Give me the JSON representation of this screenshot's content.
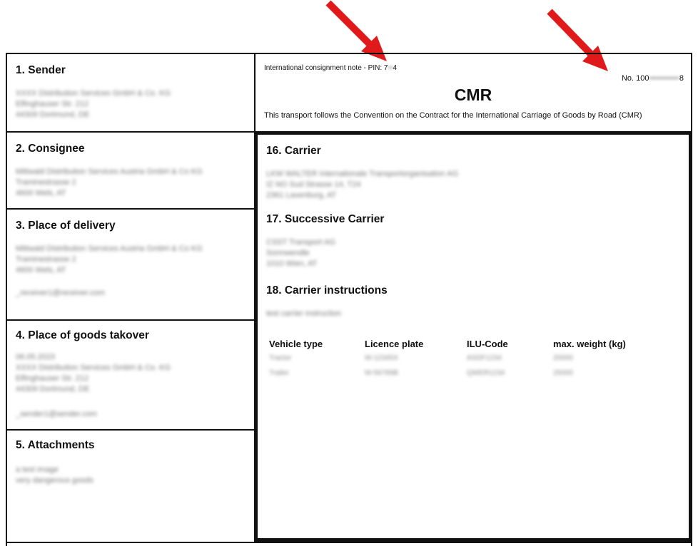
{
  "header": {
    "pin_label": "International consignment note - PIN: 7",
    "pin_masked": "••",
    "pin_suffix": "4",
    "number_prefix": "No. 100",
    "number_masked": "•••••••••••",
    "number_suffix": "8",
    "cmr_title": "CMR",
    "description": "This transport follows the Convention on the Contract for the International Carriage of Goods by Road (CMR)"
  },
  "sections": {
    "sender": {
      "title": "1. Sender",
      "lines": [
        "XXXX Distribution Services GmbH & Co. KG",
        "Elfinghauser Str. 212",
        "44309 Dortmund, DE"
      ]
    },
    "consignee": {
      "title": "2. Consignee",
      "lines": [
        "Mittwald Distribution Services Austria GmbH & Co KG",
        "Traminestrasse 2",
        "4600 Wels, AT"
      ]
    },
    "delivery": {
      "title": "3. Place of delivery",
      "lines": [
        "Mittwald Distribution Services Austria GmbH & Co KG",
        "Traminestrasse 2",
        "4600 Wels, AT"
      ],
      "email": "_receiver1@receiver.com"
    },
    "takeover": {
      "title": "4. Place of goods takover",
      "lines": [
        "06.05.2023",
        "XXXX Distribution Services GmbH & Co. KG",
        "Elfinghauser Str. 212",
        "44309 Dortmund, DE"
      ],
      "email": "_sender1@sender.com"
    },
    "attachments": {
      "title": "5. Attachments",
      "lines": [
        "a test image",
        "very dangerous goods"
      ]
    },
    "carrier": {
      "title": "16. Carrier",
      "lines": [
        "LKW WALTER Internationale Transportorganisation AG",
        "IZ NO Sud Strasse 14, T24",
        "2361 Laxenburg, AT"
      ]
    },
    "successive": {
      "title": "17. Successive Carrier",
      "lines": [
        "CSST Transport AG",
        "Sonnwendle",
        "1010 Wien, AT"
      ]
    },
    "instructions": {
      "title": "18. Carrier instructions",
      "lines": [
        "test carrier instruction"
      ]
    }
  },
  "vehicles": {
    "headers": [
      "Vehicle type",
      "Licence plate",
      "ILU-Code",
      "max. weight (kg)"
    ],
    "rows": [
      [
        "Tractor",
        "W-12345X",
        "ASDF1234",
        "20000"
      ],
      [
        "Trailer",
        "W-56789B",
        "QWER1234",
        "25000"
      ]
    ]
  },
  "colors": {
    "arrow": "#e01a1a",
    "border": "#111111"
  }
}
